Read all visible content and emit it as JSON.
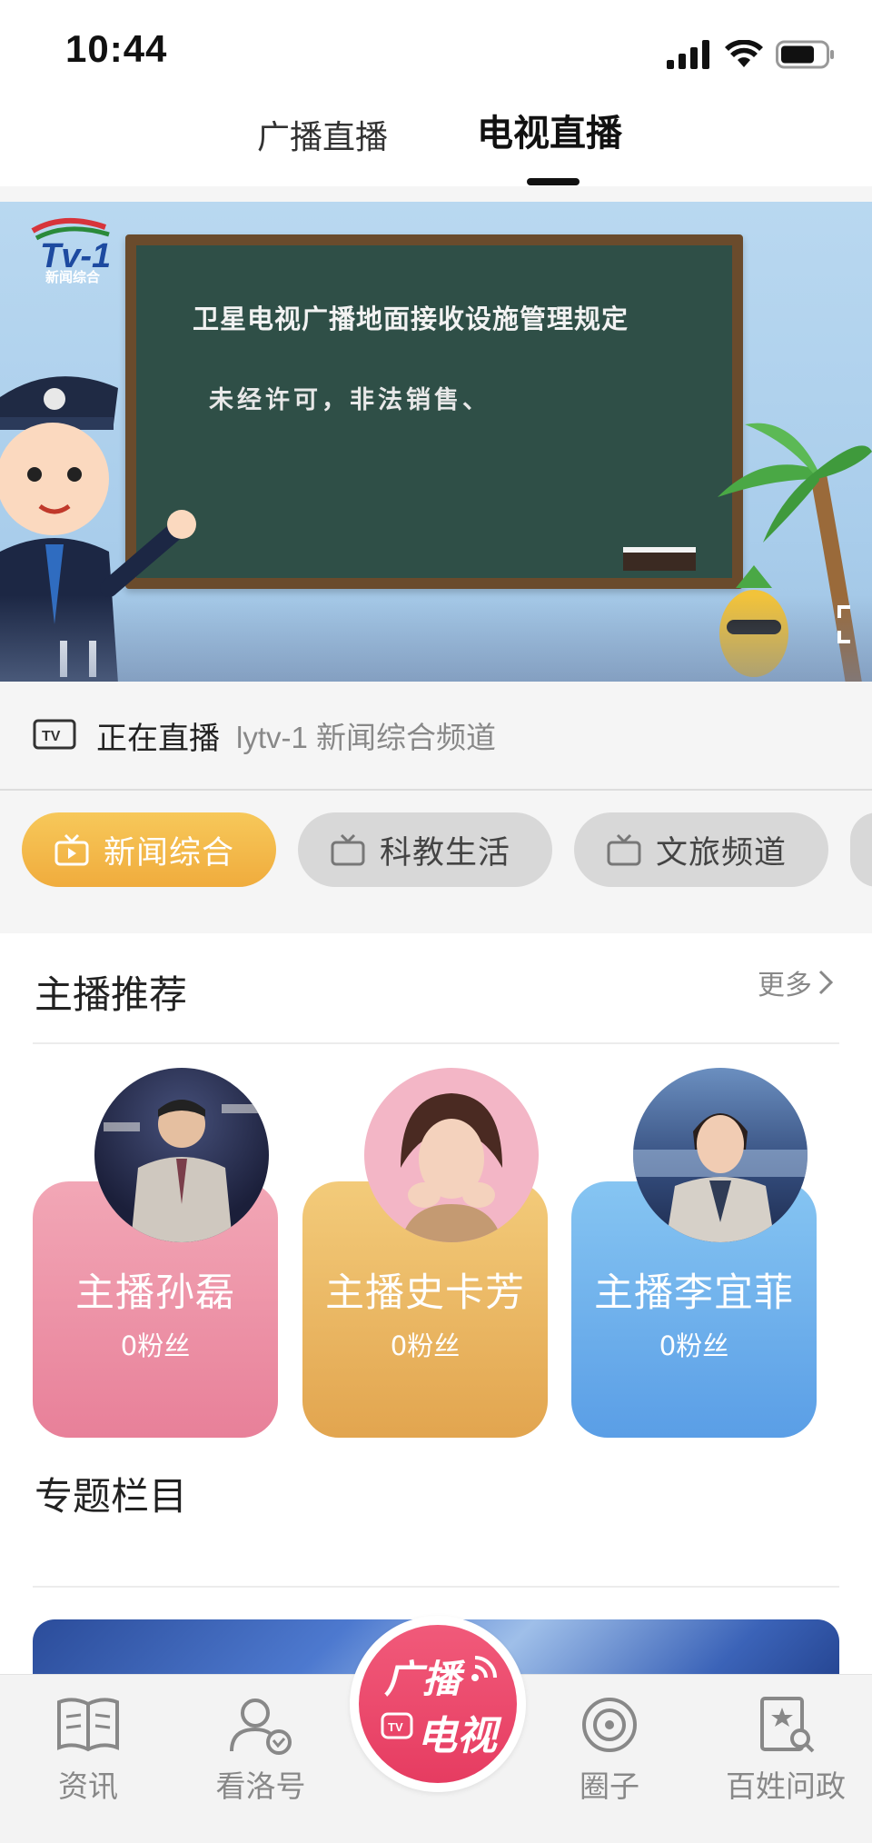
{
  "status_bar": {
    "time": "10:44",
    "icons": [
      "signal-icon",
      "wifi-icon",
      "battery-icon"
    ]
  },
  "top_tabs": [
    {
      "label": "广播直播",
      "active": false
    },
    {
      "label": "电视直播",
      "active": true
    }
  ],
  "player": {
    "logo_text": "新闻综合",
    "board_title": "卫星电视广播地面接收设施管理规定",
    "board_line": "未经许可，非法销售、"
  },
  "live_info": {
    "status": "正在直播",
    "channel": "lytv-1 新闻综合频道"
  },
  "channels": [
    {
      "label": "新闻综合",
      "active": true
    },
    {
      "label": "科教生活",
      "active": false
    },
    {
      "label": "文旅频道",
      "active": false
    }
  ],
  "anchors": {
    "title": "主播推荐",
    "more": "更多",
    "items": [
      {
        "name": "主播孙磊",
        "fans": "0粉丝",
        "theme": "pink"
      },
      {
        "name": "主播史卡芳",
        "fans": "0粉丝",
        "theme": "gold"
      },
      {
        "name": "主播李宜菲",
        "fans": "0粉丝",
        "theme": "blue"
      }
    ]
  },
  "topics": {
    "title": "专题栏目"
  },
  "bottom_nav": {
    "items": [
      {
        "label": "资讯",
        "icon": "book-icon"
      },
      {
        "label": "看洛号",
        "icon": "user-check-icon"
      },
      {
        "label": "圈子",
        "icon": "circle-icon"
      },
      {
        "label": "百姓问政",
        "icon": "report-search-icon"
      }
    ],
    "center": {
      "top": "广播",
      "bottom": "电视"
    }
  },
  "colors": {
    "accent_orange": "#f0ac3d",
    "accent_pink": "#e63c61",
    "chip_gray": "#d8d8d8"
  }
}
